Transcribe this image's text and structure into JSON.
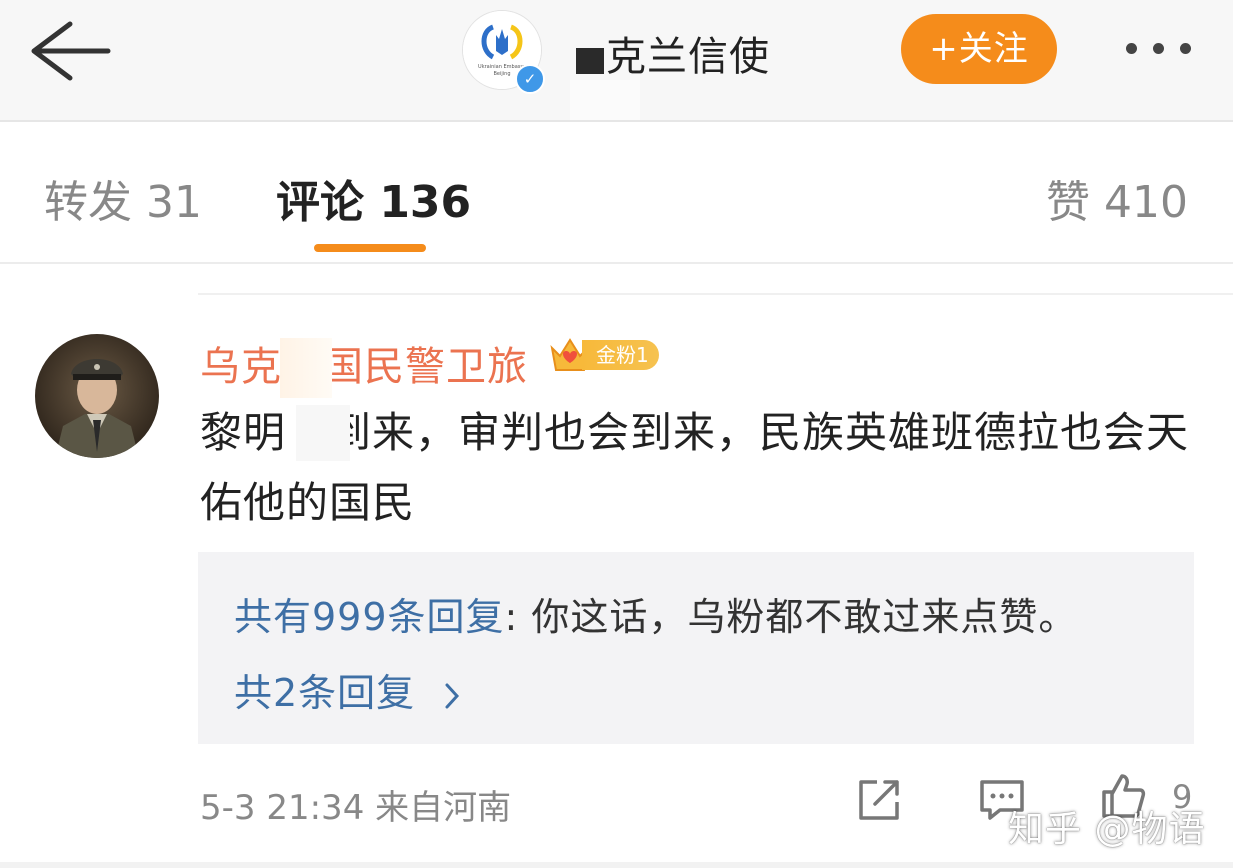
{
  "header": {
    "account_name": "克兰信使",
    "account_avatar_caption": "Ukrainian Embassy Beijing",
    "verified_mark": "✓",
    "follow_label": "+关注"
  },
  "tabs": {
    "repost": "转发 31",
    "comments": "评论 136",
    "likes": "赞 410"
  },
  "comment": {
    "author": "乌克　国民警卫旅",
    "fan_badge": "金粉1",
    "text": "黎明　到来，审判也会到来，民族英雄班德拉也会天佑他的国民",
    "reply_preview": {
      "author": "共有999条回复",
      "separator": ": ",
      "content": "你这话，乌粉都不敢过来点赞。"
    },
    "reply_more": "共2条回复",
    "meta": "5-3 21:34 来自河南",
    "like_count": "9"
  },
  "watermark": "知乎 @物语",
  "colors": {
    "accent_orange": "#f58c1b",
    "name_orange": "#eb7350",
    "link_blue": "#3e6fa5",
    "verified_blue": "#3f98e8"
  }
}
